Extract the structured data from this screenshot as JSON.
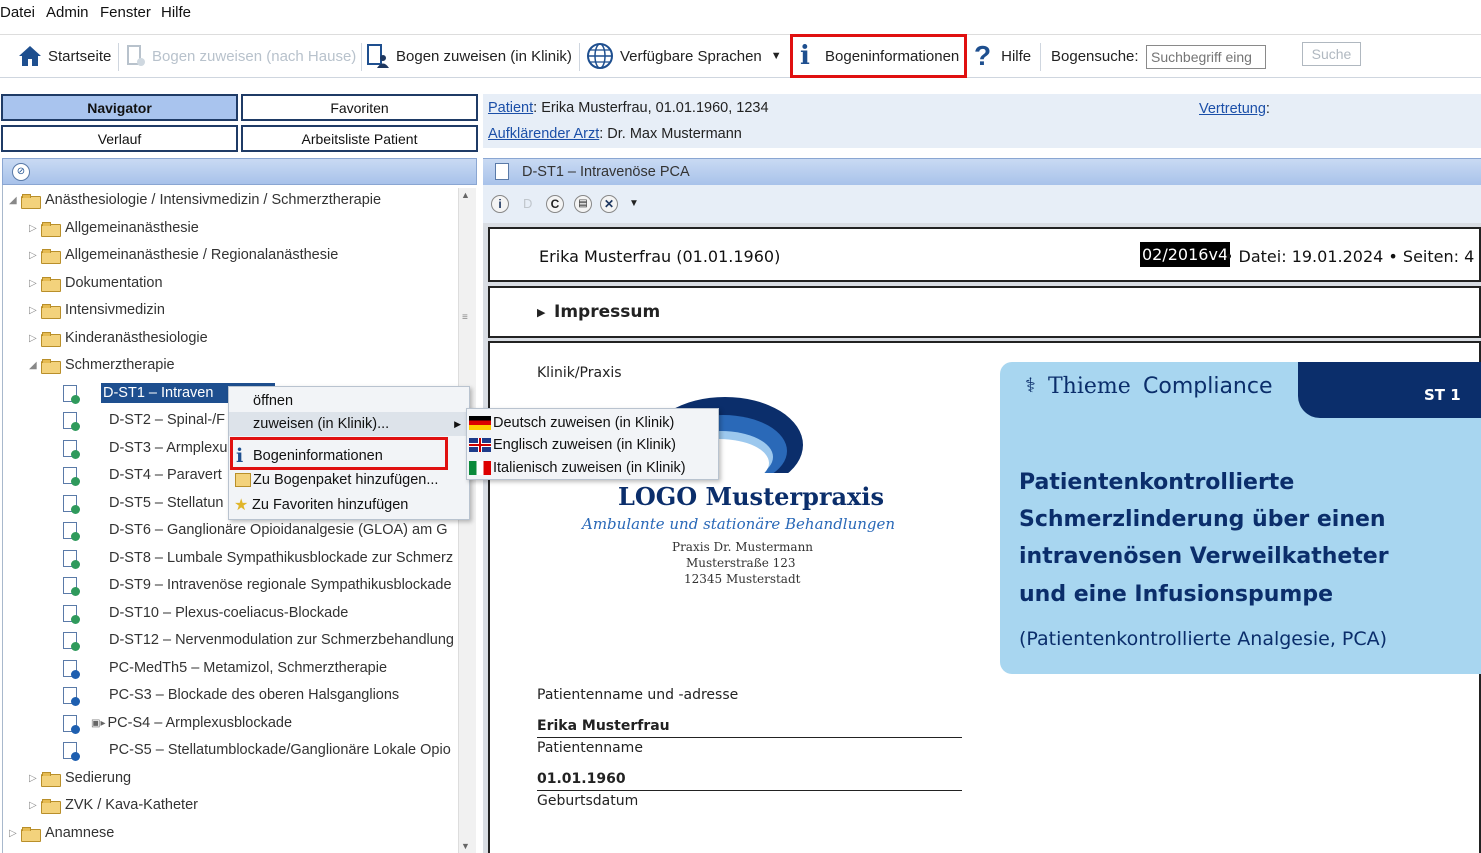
{
  "menu": [
    "Datei",
    "Admin",
    "Fenster",
    "Hilfe"
  ],
  "toolbar": {
    "home": "Startseite",
    "assign_home": "Bogen zuweisen (nach Hause)",
    "assign_clinic": "Bogen zuweisen (in Klinik)",
    "languages": "Verfügbare Sprachen",
    "info": "Bogeninformationen",
    "help": "Hilfe",
    "search_label": "Bogensuche:",
    "search_placeholder": "Suchbegriff eing",
    "search_button": "Suche"
  },
  "nav_tabs": [
    "Navigator",
    "Favoriten",
    "Verlauf",
    "Arbeitsliste Patient"
  ],
  "patient": {
    "label": "Patient",
    "value": ": Erika Musterfrau, 01.01.1960, 1234",
    "doctor_label": "Aufklärender Arzt",
    "doctor_value": ": Dr. Max Mustermann",
    "substitute_label": "Vertretung",
    "substitute_suffix": ":"
  },
  "tree": {
    "root": "Anästhesiologie / Intensivmedizin / Schmerztherapie",
    "folders": [
      "Allgemeinanästhesie",
      "Allgemeinanästhesie / Regionalanästhesie",
      "Dokumentation",
      "Intensivmedizin",
      "Kinderanästhesiologie"
    ],
    "open_folder": "Schmerztherapie",
    "items": [
      "D-ST1 – Intraven",
      "D-ST2 – Spinal-/F",
      "D-ST3 – Armplexu",
      "D-ST4 – Paravert",
      "D-ST5 – Stellatun",
      "D-ST6 – Ganglionäre Opioidanalgesie (GLOA) am G",
      "D-ST8 – Lumbale Sympathikusblockade zur Schmerz",
      "D-ST9 – Intravenöse regionale Sympathikusblockade",
      "D-ST10 – Plexus-coeliacus-Blockade",
      "D-ST12 – Nervenmodulation zur Schmerzbehandlung",
      "PC-MedTh5 – Metamizol, Schmerztherapie",
      "PC-S3 – Blockade des oberen Halsganglions",
      "PC-S4 – Armplexusblockade",
      "PC-S5 – Stellatumblockade/Ganglionäre Lokale Opio"
    ],
    "after_folders": [
      "Sedierung",
      "ZVK / Kava-Katheter"
    ],
    "root2": "Anamnese"
  },
  "context_menu": {
    "open": "öffnen",
    "assign": "zuweisen (in Klinik)...",
    "info": "Bogeninformationen",
    "add_package": "Zu Bogenpaket hinzufügen...",
    "add_fav": "Zu Favoriten hinzufügen"
  },
  "submenu": [
    "Deutsch zuweisen (in Klinik)",
    "Englisch zuweisen (in Klinik)",
    "Italienisch zuweisen (in Klinik)"
  ],
  "doc": {
    "title": "D-ST1 – Intravenöse PCA",
    "patient_line": "Erika  Musterfrau (01.01.1960)",
    "version": "02/2016v4",
    "meta": " • Datei: 19.01.2024 • Seiten: 4",
    "impressum": "Impressum",
    "clinic_label": "Klinik/Praxis",
    "logo_title": "LOGO Musterpraxis",
    "logo_sub": "Ambulante und stationäre Behandlungen",
    "logo_addr1": "Praxis Dr. Mustermann",
    "logo_addr2": "Musterstraße 123",
    "logo_addr3": "12345 Musterstadt",
    "thieme_brand": "Thieme",
    "thieme_compliance": "Compliance",
    "code": "ST 1",
    "heading": [
      "Patientenkontrollierte",
      "Schmerzlinderung über einen",
      "intravenösen Verweilkatheter",
      "und eine Infusionspumpe"
    ],
    "subheading": "(Patientenkontrollierte Analgesie, PCA)",
    "addr_label": "Patientenname und -adresse",
    "patient_name": "Erika Musterfrau",
    "patient_name_label": "Patientenname",
    "dob": "01.01.1960",
    "dob_label": "Geburtsdatum"
  }
}
